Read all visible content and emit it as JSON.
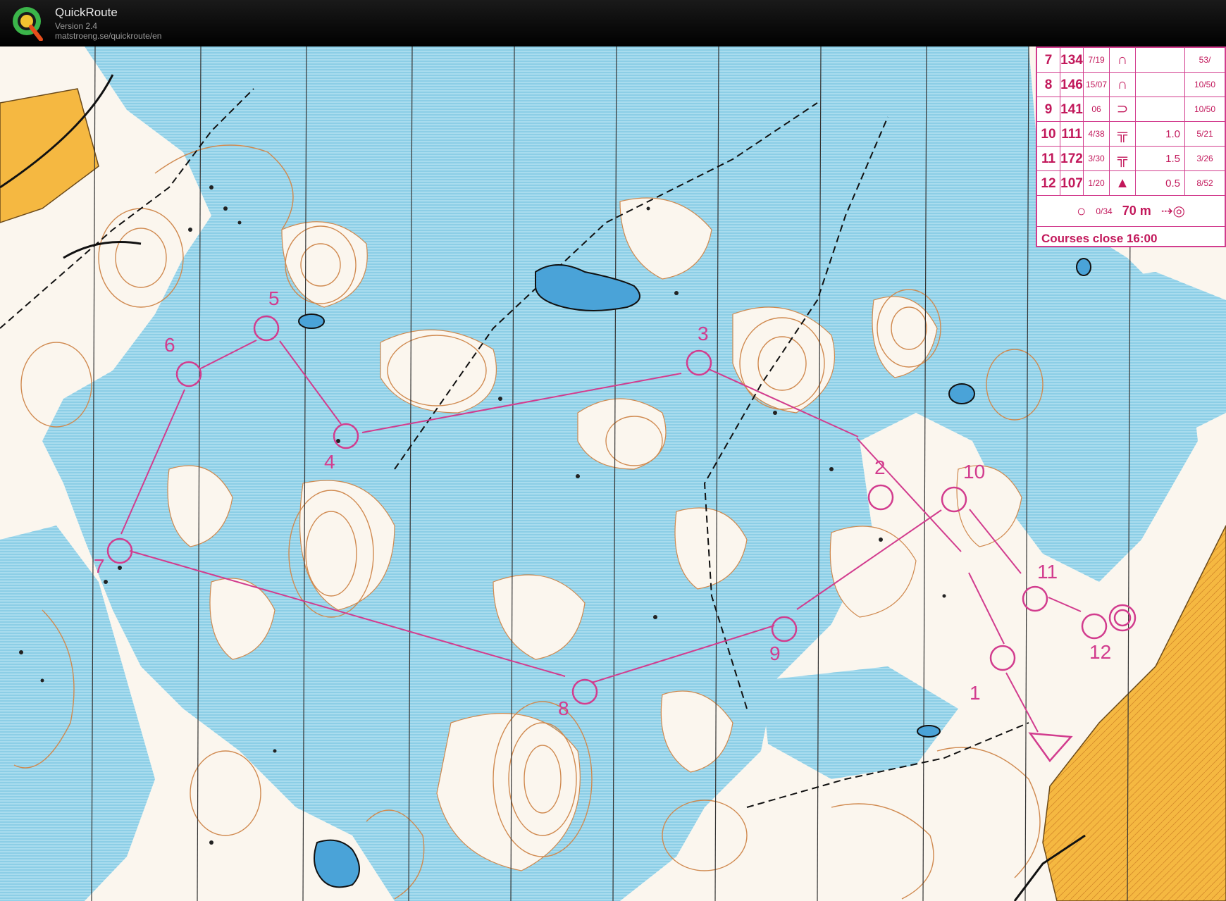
{
  "app": {
    "title": "QuickRoute",
    "version": "Version 2.4",
    "url": "matstroeng.se/quickroute/en",
    "logo_icon": "quickroute-q-logo"
  },
  "colors": {
    "course": "#d23c8e",
    "marsh": "#8fcfe6",
    "open": "#fbf6ee",
    "contour": "#d08a50",
    "field": "#f5b841",
    "water": "#2a5a9a"
  },
  "control_table": {
    "rows": [
      {
        "num": "7",
        "code": "134",
        "feature": "7/19",
        "symbol": "hill-symbol",
        "dim": "",
        "extra": "53/"
      },
      {
        "num": "8",
        "code": "146",
        "feature": "15/07",
        "symbol": "hill-symbol",
        "dim": "",
        "extra": "10/50"
      },
      {
        "num": "9",
        "code": "141",
        "feature": "06",
        "symbol": "spur-symbol",
        "dim": "",
        "extra": "10/50"
      },
      {
        "num": "10",
        "code": "111",
        "feature": "4/38",
        "symbol": "wall-symbol",
        "dim": "1.0",
        "extra": "5/21"
      },
      {
        "num": "11",
        "code": "172",
        "feature": "3/30",
        "symbol": "wall-symbol",
        "dim": "1.5",
        "extra": "3/26"
      },
      {
        "num": "12",
        "code": "107",
        "feature": "1/20",
        "symbol": "boulder-symbol",
        "dim": "0.5",
        "extra": "8/52"
      }
    ],
    "finish": {
      "fraction": "0/34",
      "distance": "70 m"
    },
    "courses_close": "Courses close 16:00"
  },
  "course": {
    "start_label": "start-triangle",
    "finish_label": "finish-double-circle",
    "controls": [
      {
        "id": "1",
        "label": "1"
      },
      {
        "id": "2",
        "label": "2"
      },
      {
        "id": "3",
        "label": "3"
      },
      {
        "id": "4",
        "label": "4"
      },
      {
        "id": "5",
        "label": "5"
      },
      {
        "id": "6",
        "label": "6"
      },
      {
        "id": "7",
        "label": "7"
      },
      {
        "id": "8",
        "label": "8"
      },
      {
        "id": "9",
        "label": "9"
      },
      {
        "id": "10",
        "label": "10"
      },
      {
        "id": "11",
        "label": "11"
      },
      {
        "id": "12",
        "label": "12"
      }
    ]
  }
}
